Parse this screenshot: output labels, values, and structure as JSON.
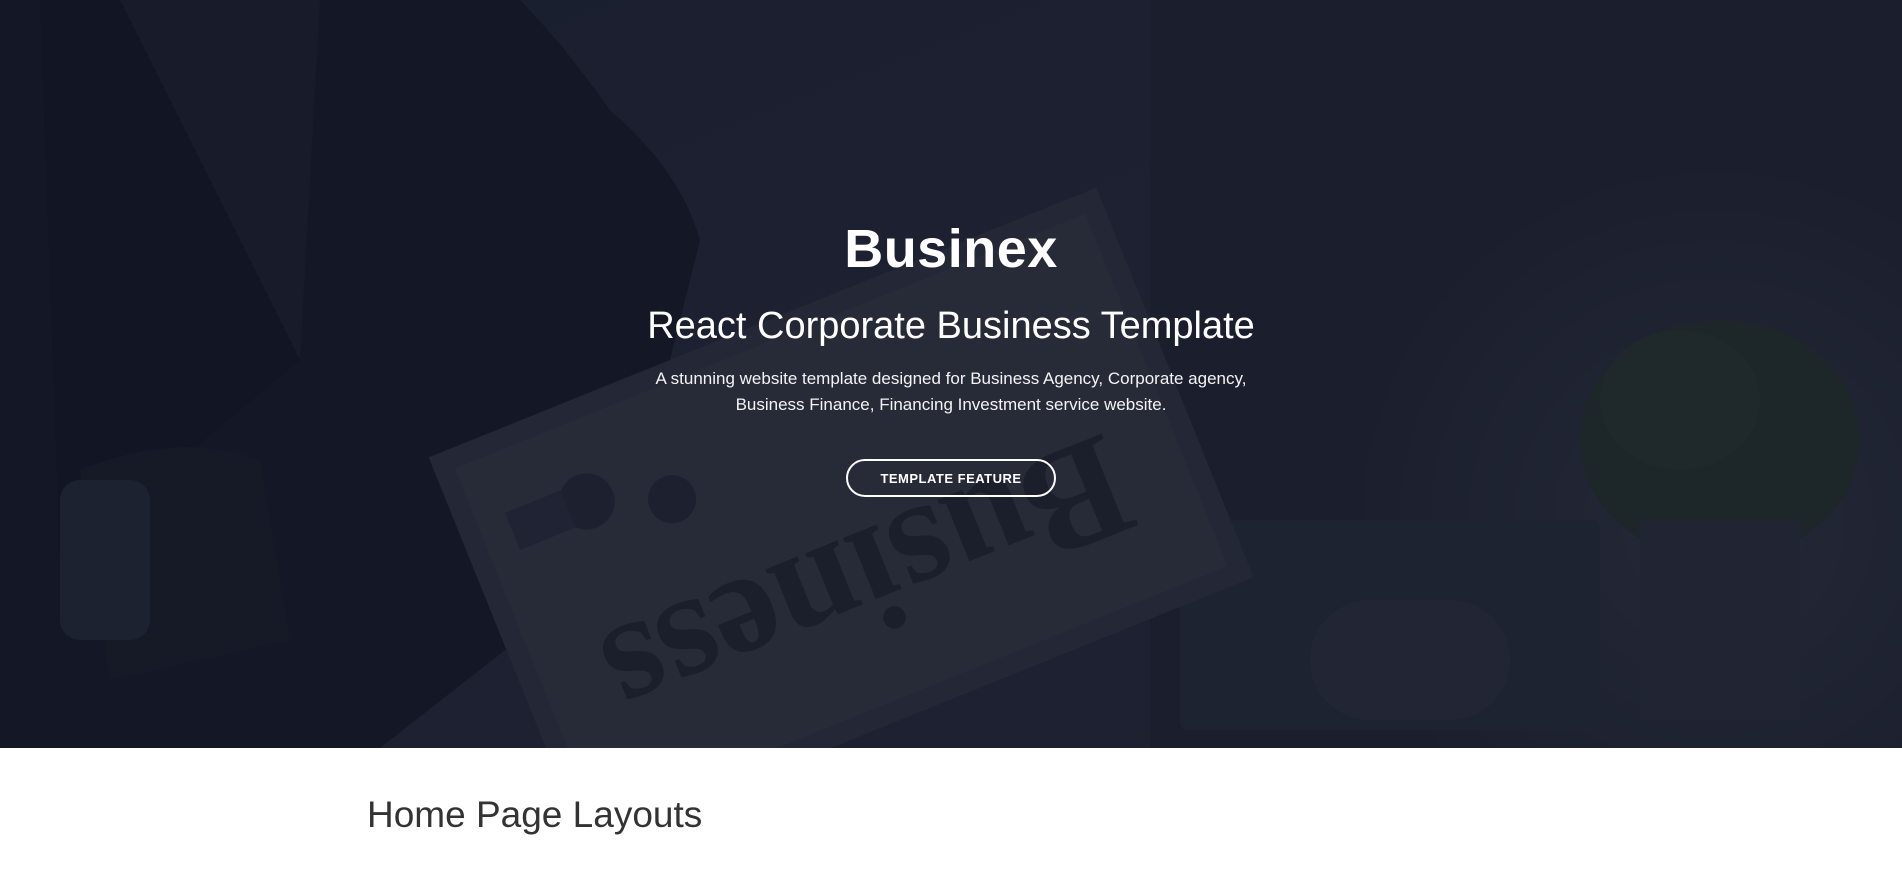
{
  "hero": {
    "title": "Businex",
    "subtitle": "React Corporate Business Template",
    "description": "A stunning website template designed for Business Agency, Corporate agency, Business Finance, Financing Investment service website.",
    "button_label": "TEMPLATE FEATURE",
    "background_image": "businessman-reading-newspaper-photo",
    "newspaper_word": "Business"
  },
  "section": {
    "title": "Home Page Layouts"
  },
  "colors": {
    "hero_overlay": "#121524",
    "text_light": "#ffffff",
    "section_title": "#333333"
  }
}
